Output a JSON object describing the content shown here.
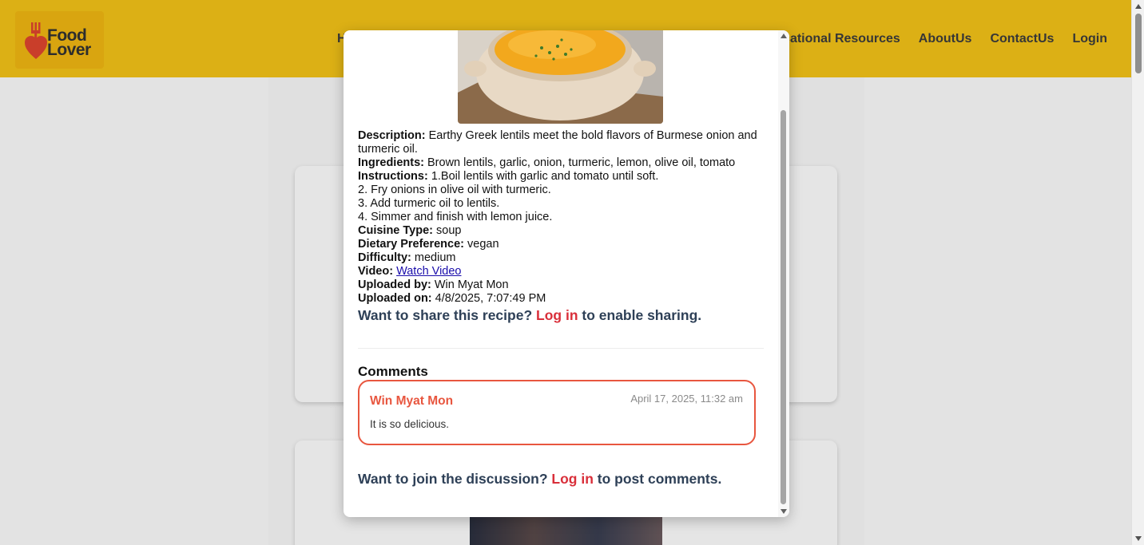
{
  "nav": {
    "brand_line1": "Food",
    "brand_line2": "Lover",
    "partial_first_link": "H",
    "links": [
      "Educational Resources",
      "AboutUs",
      "ContactUs",
      "Login"
    ],
    "brand_color": "#f5c518"
  },
  "modal": {
    "image_alt": "Bowl of lentil soup",
    "labels": {
      "description": "Description:",
      "ingredients": "Ingredients:",
      "instructions": "Instructions:",
      "cuisine": "Cuisine Type:",
      "dietary": "Dietary Preference:",
      "difficulty": "Difficulty:",
      "video": "Video:",
      "uploaded_by": "Uploaded by:",
      "uploaded_on": "Uploaded on:"
    },
    "description": "Earthy Greek lentils meet the bold flavors of Burmese onion and turmeric oil.",
    "ingredients": "Brown lentils, garlic, onion, turmeric, lemon, olive oil, tomato",
    "instructions_first": "1.Boil lentils with garlic and tomato until soft.",
    "instructions_rest": [
      "2. Fry onions in olive oil with turmeric.",
      "3. Add turmeric oil to lentils.",
      "4. Simmer and finish with lemon juice."
    ],
    "cuisine": "soup",
    "dietary": "vegan",
    "difficulty": "medium",
    "video_link": "Watch Video",
    "uploaded_by": "Win Myat Mon",
    "uploaded_on": "4/8/2025, 7:07:49 PM",
    "share_prefix": "Want to share this recipe?",
    "share_login": "Log in",
    "share_suffix": "to enable sharing.",
    "comments_heading": "Comments",
    "comments": [
      {
        "author": "Win Myat Mon",
        "time": "April 17, 2025, 11:32 am",
        "text": "It is so delicious."
      }
    ],
    "discuss_prefix": "Want to join the discussion?",
    "discuss_login": "Log in",
    "discuss_suffix": "to post comments.",
    "accent_color": "#e8563f",
    "login_color": "#d92f3a",
    "cta_color": "#2e4057"
  }
}
